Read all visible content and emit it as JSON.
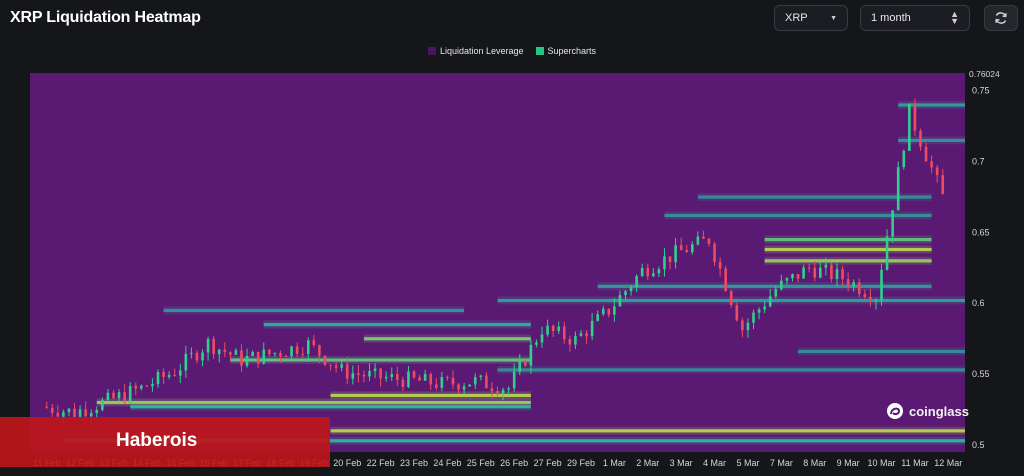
{
  "header": {
    "title": "XRP Liquidation Heatmap",
    "symbol_select": "XRP",
    "range_select": "1 month"
  },
  "watermark": "coinglass",
  "banner": "Haberois",
  "colors": {
    "background": "#15161a",
    "heatmap_base": "#5a1a74",
    "liquidation_leverage": "#4a1660",
    "supercharts": "#27c48a",
    "candle_up": "#2fd08c",
    "candle_down": "#ee4a61",
    "banner": "#c0151a"
  },
  "chart_data": {
    "type": "heatmap",
    "title": "XRP Liquidation Heatmap",
    "legend": [
      "Liquidation Leverage",
      "Supercharts"
    ],
    "legend_position": "top-center",
    "y_axis": {
      "position": "right",
      "ticks": [
        0.5,
        0.55,
        0.6,
        0.65,
        0.7,
        0.75
      ],
      "current_price_label": "0.76024",
      "ylim": [
        0.495,
        0.7625
      ]
    },
    "x_labels": [
      "11 Feb",
      "12 Feb",
      "13 Feb",
      "14 Feb",
      "15 Feb",
      "16 Feb",
      "17 Feb",
      "18 Feb",
      "19 Feb",
      "20 Feb",
      "22 Feb",
      "23 Feb",
      "24 Feb",
      "25 Feb",
      "26 Feb",
      "27 Feb",
      "29 Feb",
      "1 Mar",
      "2 Mar",
      "3 Mar",
      "4 Mar",
      "5 Mar",
      "7 Mar",
      "8 Mar",
      "9 Mar",
      "10 Mar",
      "11 Mar",
      "12 Mar"
    ],
    "price_path": [
      [
        0,
        0.527
      ],
      [
        1,
        0.523
      ],
      [
        2,
        0.531
      ],
      [
        3,
        0.54
      ],
      [
        4,
        0.552
      ],
      [
        5,
        0.572
      ],
      [
        6,
        0.56
      ],
      [
        7,
        0.565
      ],
      [
        8,
        0.571
      ],
      [
        9,
        0.552
      ],
      [
        10,
        0.548
      ],
      [
        11,
        0.546
      ],
      [
        12,
        0.543
      ],
      [
        13,
        0.545
      ],
      [
        14,
        0.54
      ],
      [
        15,
        0.582
      ],
      [
        16,
        0.574
      ],
      [
        17,
        0.595
      ],
      [
        18,
        0.623
      ],
      [
        19,
        0.635
      ],
      [
        20,
        0.645
      ],
      [
        21,
        0.582
      ],
      [
        22,
        0.61
      ],
      [
        23,
        0.625
      ],
      [
        24,
        0.618
      ],
      [
        25,
        0.605
      ],
      [
        26,
        0.735
      ],
      [
        27,
        0.675
      ]
    ],
    "liquidation_bands": [
      {
        "from": 2,
        "to": 15,
        "price": 0.53,
        "intensity": 0.9
      },
      {
        "from": 3,
        "to": 15,
        "price": 0.527,
        "intensity": 0.7
      },
      {
        "from": 9,
        "to": 15,
        "price": 0.535,
        "intensity": 0.95
      },
      {
        "from": 6,
        "to": 15,
        "price": 0.56,
        "intensity": 0.8
      },
      {
        "from": 10,
        "to": 15,
        "price": 0.575,
        "intensity": 0.85
      },
      {
        "from": 7,
        "to": 15,
        "price": 0.585,
        "intensity": 0.6
      },
      {
        "from": 4,
        "to": 13,
        "price": 0.595,
        "intensity": 0.4
      },
      {
        "from": 14,
        "to": 28,
        "price": 0.602,
        "intensity": 0.5
      },
      {
        "from": 17,
        "to": 27,
        "price": 0.612,
        "intensity": 0.45
      },
      {
        "from": 22,
        "to": 27,
        "price": 0.63,
        "intensity": 0.9
      },
      {
        "from": 22,
        "to": 27,
        "price": 0.638,
        "intensity": 0.95
      },
      {
        "from": 22,
        "to": 27,
        "price": 0.645,
        "intensity": 0.8
      },
      {
        "from": 19,
        "to": 27,
        "price": 0.662,
        "intensity": 0.4
      },
      {
        "from": 20,
        "to": 27,
        "price": 0.675,
        "intensity": 0.35
      },
      {
        "from": 23,
        "to": 28,
        "price": 0.566,
        "intensity": 0.35
      },
      {
        "from": 14,
        "to": 28,
        "price": 0.553,
        "intensity": 0.35
      },
      {
        "from": 9,
        "to": 28,
        "price": 0.51,
        "intensity": 0.95
      },
      {
        "from": 1,
        "to": 28,
        "price": 0.503,
        "intensity": 0.7
      },
      {
        "from": 26,
        "to": 28,
        "price": 0.715,
        "intensity": 0.4
      },
      {
        "from": 26,
        "to": 28,
        "price": 0.74,
        "intensity": 0.5
      }
    ]
  }
}
